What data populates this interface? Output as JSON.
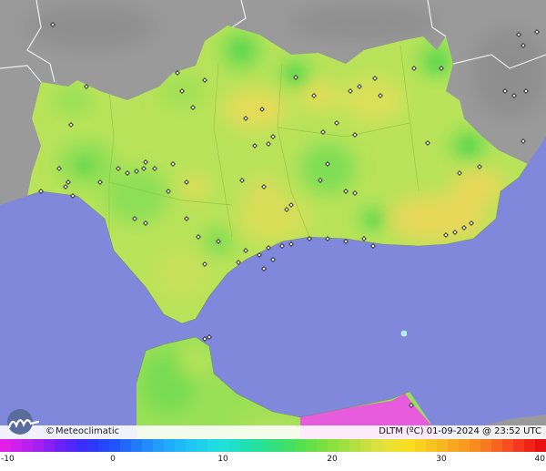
{
  "brand": {
    "copyright": "©",
    "name": "Meteoclimatic"
  },
  "variable_label": "DLTM (ºC)",
  "timestamp": "01-09-2024 @ 23:52 UTC",
  "legend": {
    "ticks": [
      "-10",
      "0",
      "10",
      "20",
      "30",
      "40"
    ],
    "min": -10,
    "max": 40
  },
  "colors": {
    "sea": "#8088dc",
    "land_outside": "#9a9a9a",
    "land_main": "#b8e35a",
    "warm_spots": "#e8d85a",
    "cool_spots": "#74dc52",
    "hot_pink": "#e65cdc"
  },
  "icons": {
    "logo": "meteoclimatic-wave-logo",
    "stations": "station-marker-icon"
  }
}
